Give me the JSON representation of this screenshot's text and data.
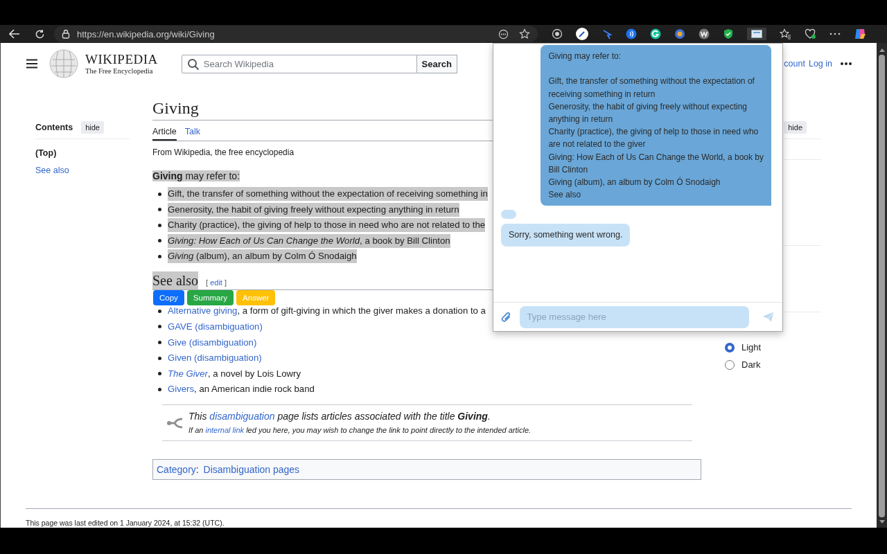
{
  "browser": {
    "url": "https://en.wikipedia.org/wiki/Giving"
  },
  "header": {
    "logo_title": "WIKIPEDIA",
    "logo_subtitle": "The Free Encyclopedia",
    "search_placeholder": "Search Wikipedia",
    "search_button": "Search",
    "account_link": "count",
    "login_link": "Log in"
  },
  "sidebar": {
    "title": "Contents",
    "hide_button": "hide",
    "items": [
      {
        "label": "(Top)",
        "selected": true
      },
      {
        "label": "See also",
        "selected": false
      }
    ]
  },
  "article": {
    "title": "Giving",
    "tabs": [
      {
        "label": "Article",
        "selected": true
      },
      {
        "label": "Talk",
        "selected": false
      }
    ],
    "tagline": "From Wikipedia, the free encyclopedia",
    "intro": {
      "text": "**Giving** may refer to:",
      "highlighted": true
    },
    "items": [
      {
        "text": "Gift, the transfer of something without the expectation of receiving something in",
        "highlighted": true
      },
      {
        "text": "Generosity, the habit of giving freely without expecting anything in return",
        "highlighted": true
      },
      {
        "text": "Charity (practice), the giving of help to those in need who are not related to the",
        "highlighted": true
      },
      {
        "text": "*Giving: How Each of Us Can Change the World*, a book by Bill Clinton",
        "highlighted": true
      },
      {
        "text": "*Giving* (album), an album by Colm Ó Snodaigh",
        "highlighted": true
      }
    ],
    "see_also": {
      "heading": "See also",
      "highlighted": true,
      "edit_brackets": [
        "[",
        "]"
      ],
      "edit_link": "edit",
      "items": [
        {
          "link": "Alternative giving",
          "text": ", a form of gift-giving in which the giver makes a donation to a"
        },
        {
          "link": "GAVE (disambiguation)"
        },
        {
          "link": "Give (disambiguation)"
        },
        {
          "link": "Given (disambiguation)"
        },
        {
          "link": "*The Giver*",
          "text": ", a novel by Lois Lowry"
        },
        {
          "link": "Givers",
          "text": ", an American indie rock band"
        }
      ]
    },
    "hatnote": [
      {
        "before": "This ",
        "link": "disambiguation",
        "after": " page lists articles associated with the title **Giving**."
      },
      {
        "before": "If an ",
        "link": "internal link",
        "after": " led you here, you may wish to change the link to point directly to the intended article."
      }
    ],
    "category": {
      "label": "Category",
      "separator": ":",
      "link": "Disambiguation pages"
    }
  },
  "right_panel": {
    "hide_button": "hide",
    "theme_options": [
      {
        "label": "Light",
        "selected": true
      },
      {
        "label": "Dark",
        "selected": false
      }
    ]
  },
  "footer": {
    "text": "This page was last edited on 1 January 2024, at 15:32 (UTC)."
  },
  "selection_toolbar": [
    {
      "label": "Copy",
      "color": "#0d6efd"
    },
    {
      "label": "Summary",
      "color": "#28a745"
    },
    {
      "label": "Answer",
      "color": "#ffc107"
    }
  ],
  "chat": {
    "messages": [
      {
        "kind": "user",
        "text": "Giving may refer to:\n\nGift, the transfer of something without the expectation of\nreceiving something in return\nGenerosity, the habit of giving freely without expecting\nanything in return\nCharity (practice), the giving of help to those in need who\nare not related to the giver\nGiving: How Each of Us Can Change the World, a book by\nBill Clinton\nGiving (album), an album by Colm Ó Snodaigh\nSee also"
      },
      {
        "kind": "blank"
      },
      {
        "kind": "bot",
        "text": "Sorry, something went wrong."
      }
    ],
    "input_placeholder": "Type message here"
  }
}
